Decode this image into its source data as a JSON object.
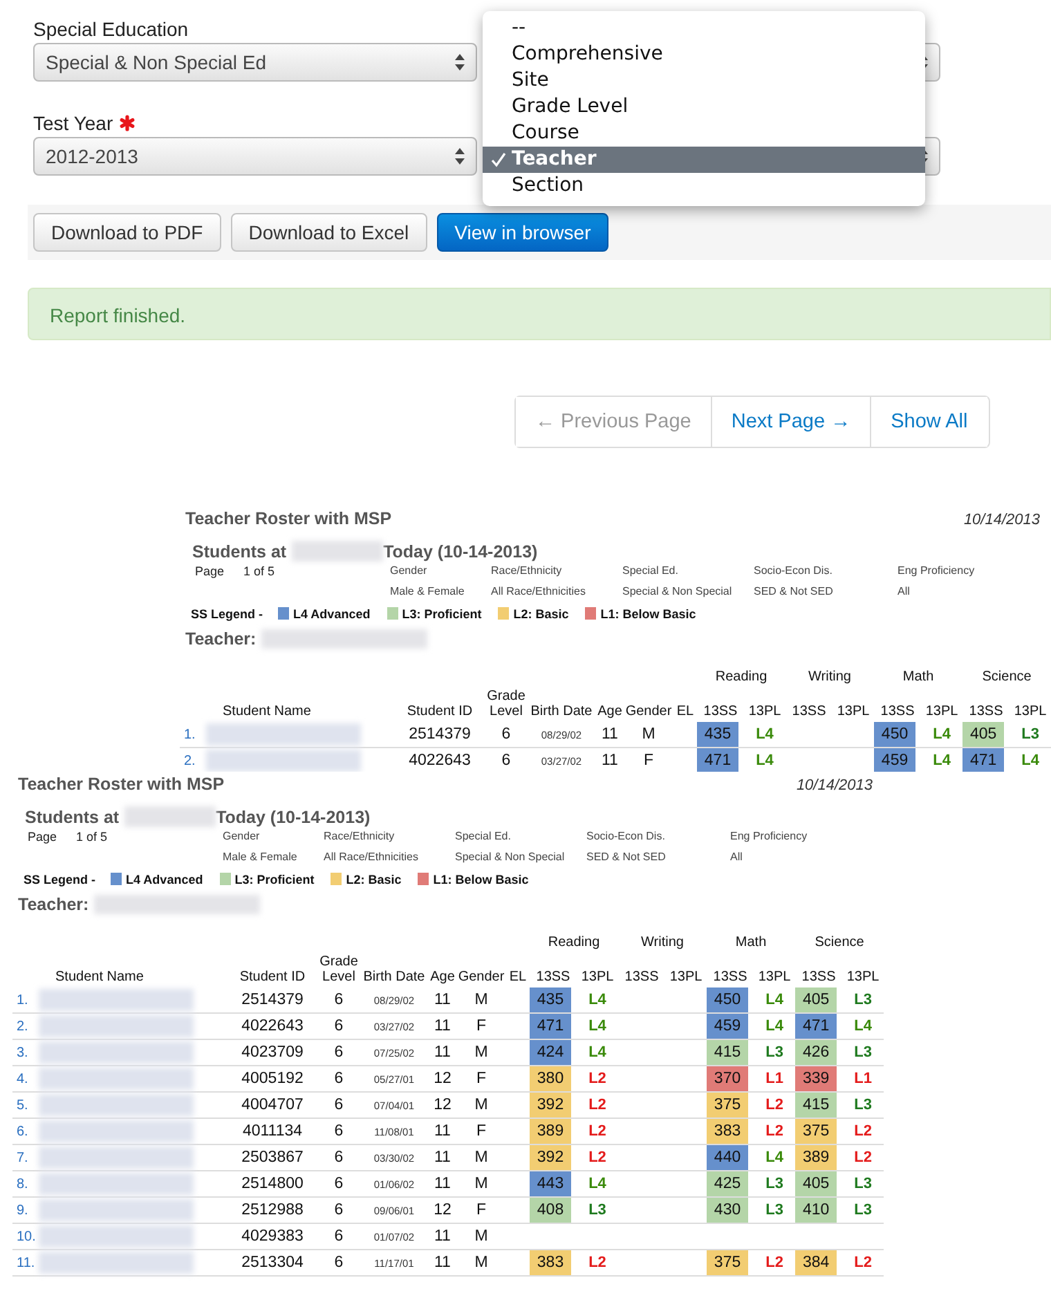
{
  "form": {
    "fields": [
      {
        "label": "Special Education",
        "value": "Special & Non Special Ed",
        "required": false
      },
      {
        "label": "Test Year",
        "value": "2012-2013",
        "required": true
      }
    ],
    "group_by_menu": {
      "options": [
        {
          "label": "--",
          "selected": false
        },
        {
          "label": "Comprehensive",
          "selected": false
        },
        {
          "label": "Site",
          "selected": false
        },
        {
          "label": "Grade Level",
          "selected": false
        },
        {
          "label": "Course",
          "selected": false
        },
        {
          "label": "Teacher",
          "selected": true
        },
        {
          "label": "Section",
          "selected": false
        }
      ]
    }
  },
  "buttons": [
    {
      "label": "Download to PDF",
      "kind": "default"
    },
    {
      "label": "Download to Excel",
      "kind": "default"
    },
    {
      "label": "View in browser",
      "kind": "primary"
    }
  ],
  "alert": "Report finished.",
  "pagination": [
    {
      "label": "← Previous Page",
      "disabled": true
    },
    {
      "label": "Next Page →",
      "disabled": false
    },
    {
      "label": "Show All",
      "disabled": false
    }
  ],
  "reports": [
    {
      "title": "Teacher Roster with MSP",
      "date": "10/14/2013",
      "students_at": "Students at",
      "students_suffix": "Today (10-14-2013)",
      "page_label": "Page",
      "page_value": "1 of 5",
      "filters": [
        {
          "label": "Gender",
          "value": "Male & Female"
        },
        {
          "label": "Race/Ethnicity",
          "value": "All Race/Ethnicities"
        },
        {
          "label": "Special Ed.",
          "value": "Special & Non Special"
        },
        {
          "label": "Socio-Econ Dis.",
          "value": "SED & Not SED"
        },
        {
          "label": "Eng Proficiency",
          "value": "All"
        }
      ],
      "legend_label": "SS Legend -",
      "legend": [
        {
          "label": "L4 Advanced",
          "color": "#6690cc"
        },
        {
          "label": "L3: Proficient",
          "color": "#b4d5a8"
        },
        {
          "label": "L2: Basic",
          "color": "#f2cd72"
        },
        {
          "label": "L1: Below Basic",
          "color": "#e07b77"
        }
      ],
      "teacher_label": "Teacher:",
      "columns": [
        "Student Name",
        "Student ID",
        "Grade Level",
        "Birth Date",
        "Age",
        "Gender",
        "EL"
      ],
      "subjects": [
        {
          "name": "Reading",
          "columns": [
            "13SS",
            "13PL"
          ]
        },
        {
          "name": "Writing",
          "columns": [
            "13SS",
            "13PL"
          ]
        },
        {
          "name": "Math",
          "columns": [
            "13SS",
            "13PL"
          ]
        },
        {
          "name": "Science",
          "columns": [
            "13SS",
            "13PL"
          ]
        }
      ],
      "rows": [
        {
          "number": "1.",
          "id": "2514379",
          "grade": "6",
          "birth": "08/29/02",
          "age": "11",
          "gender": "M",
          "scores": [
            {
              "kind": "score",
              "ss": "435",
              "pl": "L4",
              "color": "#6690cc"
            },
            {
              "kind": "empty"
            },
            {
              "kind": "score",
              "ss": "450",
              "pl": "L4",
              "color": "#6690cc"
            },
            {
              "kind": "score",
              "ss": "405",
              "pl": "L3",
              "color": "#b4d5a8"
            }
          ]
        },
        {
          "number": "2.",
          "id": "4022643",
          "grade": "6",
          "birth": "03/27/02",
          "age": "11",
          "gender": "F",
          "scores": [
            {
              "kind": "score",
              "ss": "471",
              "pl": "L4",
              "color": "#6690cc"
            },
            {
              "kind": "empty"
            },
            {
              "kind": "score",
              "ss": "459",
              "pl": "L4",
              "color": "#6690cc"
            },
            {
              "kind": "score",
              "ss": "471",
              "pl": "L4",
              "color": "#6690cc"
            }
          ]
        }
      ]
    },
    {
      "title": "Teacher Roster with MSP",
      "date": "10/14/2013",
      "students_at": "Students at",
      "students_suffix": "Today (10-14-2013)",
      "page_label": "Page",
      "page_value": "1 of 5",
      "filters": [
        {
          "label": "Gender",
          "value": "Male & Female"
        },
        {
          "label": "Race/Ethnicity",
          "value": "All Race/Ethnicities"
        },
        {
          "label": "Special Ed.",
          "value": "Special & Non Special"
        },
        {
          "label": "Socio-Econ Dis.",
          "value": "SED & Not SED"
        },
        {
          "label": "Eng Proficiency",
          "value": "All"
        }
      ],
      "legend_label": "SS Legend -",
      "legend": [
        {
          "label": "L4 Advanced",
          "color": "#6690cc"
        },
        {
          "label": "L3: Proficient",
          "color": "#b4d5a8"
        },
        {
          "label": "L2: Basic",
          "color": "#f2cd72"
        },
        {
          "label": "L1: Below Basic",
          "color": "#e07b77"
        }
      ],
      "teacher_label": "Teacher:",
      "columns": [
        "Student Name",
        "Student ID",
        "Grade Level",
        "Birth Date",
        "Age",
        "Gender",
        "EL"
      ],
      "subjects": [
        {
          "name": "Reading",
          "columns": [
            "13SS",
            "13PL"
          ]
        },
        {
          "name": "Writing",
          "columns": [
            "13SS",
            "13PL"
          ]
        },
        {
          "name": "Math",
          "columns": [
            "13SS",
            "13PL"
          ]
        },
        {
          "name": "Science",
          "columns": [
            "13SS",
            "13PL"
          ]
        }
      ],
      "rows": [
        {
          "number": "1.",
          "id": "2514379",
          "grade": "6",
          "birth": "08/29/02",
          "age": "11",
          "gender": "M",
          "scores": [
            {
              "kind": "score",
              "ss": "435",
              "pl": "L4",
              "color": "#6690cc"
            },
            {
              "kind": "empty"
            },
            {
              "kind": "score",
              "ss": "450",
              "pl": "L4",
              "color": "#6690cc"
            },
            {
              "kind": "score",
              "ss": "405",
              "pl": "L3",
              "color": "#b4d5a8"
            }
          ]
        },
        {
          "number": "2.",
          "id": "4022643",
          "grade": "6",
          "birth": "03/27/02",
          "age": "11",
          "gender": "F",
          "scores": [
            {
              "kind": "score",
              "ss": "471",
              "pl": "L4",
              "color": "#6690cc"
            },
            {
              "kind": "empty"
            },
            {
              "kind": "score",
              "ss": "459",
              "pl": "L4",
              "color": "#6690cc"
            },
            {
              "kind": "score",
              "ss": "471",
              "pl": "L4",
              "color": "#6690cc"
            }
          ]
        },
        {
          "number": "3.",
          "id": "4023709",
          "grade": "6",
          "birth": "07/25/02",
          "age": "11",
          "gender": "M",
          "scores": [
            {
              "kind": "score",
              "ss": "424",
              "pl": "L4",
              "color": "#6690cc"
            },
            {
              "kind": "empty"
            },
            {
              "kind": "score",
              "ss": "415",
              "pl": "L3",
              "color": "#b4d5a8"
            },
            {
              "kind": "score",
              "ss": "426",
              "pl": "L3",
              "color": "#b4d5a8"
            }
          ]
        },
        {
          "number": "4.",
          "id": "4005192",
          "grade": "6",
          "birth": "05/27/01",
          "age": "12",
          "gender": "F",
          "scores": [
            {
              "kind": "score",
              "ss": "380",
              "pl": "L2",
              "color": "#f2cd72"
            },
            {
              "kind": "empty"
            },
            {
              "kind": "score",
              "ss": "370",
              "pl": "L1",
              "color": "#e07b77"
            },
            {
              "kind": "score",
              "ss": "339",
              "pl": "L1",
              "color": "#e07b77"
            }
          ]
        },
        {
          "number": "5.",
          "id": "4004707",
          "grade": "6",
          "birth": "07/04/01",
          "age": "12",
          "gender": "M",
          "scores": [
            {
              "kind": "score",
              "ss": "392",
              "pl": "L2",
              "color": "#f2cd72"
            },
            {
              "kind": "empty"
            },
            {
              "kind": "score",
              "ss": "375",
              "pl": "L2",
              "color": "#f2cd72"
            },
            {
              "kind": "score",
              "ss": "415",
              "pl": "L3",
              "color": "#b4d5a8"
            }
          ]
        },
        {
          "number": "6.",
          "id": "4011134",
          "grade": "6",
          "birth": "11/08/01",
          "age": "11",
          "gender": "F",
          "scores": [
            {
              "kind": "score",
              "ss": "389",
              "pl": "L2",
              "color": "#f2cd72"
            },
            {
              "kind": "empty"
            },
            {
              "kind": "score",
              "ss": "383",
              "pl": "L2",
              "color": "#f2cd72"
            },
            {
              "kind": "score",
              "ss": "375",
              "pl": "L2",
              "color": "#f2cd72"
            }
          ]
        },
        {
          "number": "7.",
          "id": "2503867",
          "grade": "6",
          "birth": "03/30/02",
          "age": "11",
          "gender": "M",
          "scores": [
            {
              "kind": "score",
              "ss": "392",
              "pl": "L2",
              "color": "#f2cd72"
            },
            {
              "kind": "empty"
            },
            {
              "kind": "score",
              "ss": "440",
              "pl": "L4",
              "color": "#6690cc"
            },
            {
              "kind": "score",
              "ss": "389",
              "pl": "L2",
              "color": "#f2cd72"
            }
          ]
        },
        {
          "number": "8.",
          "id": "2514800",
          "grade": "6",
          "birth": "01/06/02",
          "age": "11",
          "gender": "M",
          "scores": [
            {
              "kind": "score",
              "ss": "443",
              "pl": "L4",
              "color": "#6690cc"
            },
            {
              "kind": "empty"
            },
            {
              "kind": "score",
              "ss": "425",
              "pl": "L3",
              "color": "#b4d5a8"
            },
            {
              "kind": "score",
              "ss": "405",
              "pl": "L3",
              "color": "#b4d5a8"
            }
          ]
        },
        {
          "number": "9.",
          "id": "2512988",
          "grade": "6",
          "birth": "09/06/01",
          "age": "12",
          "gender": "F",
          "scores": [
            {
              "kind": "score",
              "ss": "408",
              "pl": "L3",
              "color": "#b4d5a8"
            },
            {
              "kind": "empty"
            },
            {
              "kind": "score",
              "ss": "430",
              "pl": "L3",
              "color": "#b4d5a8"
            },
            {
              "kind": "score",
              "ss": "410",
              "pl": "L3",
              "color": "#b4d5a8"
            }
          ]
        },
        {
          "number": "10.",
          "id": "4029383",
          "grade": "6",
          "birth": "01/07/02",
          "age": "11",
          "gender": "M",
          "scores": [
            {
              "kind": "empty"
            },
            {
              "kind": "empty"
            },
            {
              "kind": "empty"
            },
            {
              "kind": "empty"
            }
          ]
        },
        {
          "number": "11.",
          "id": "2513304",
          "grade": "6",
          "birth": "11/17/01",
          "age": "11",
          "gender": "M",
          "scores": [
            {
              "kind": "score",
              "ss": "383",
              "pl": "L2",
              "color": "#f2cd72"
            },
            {
              "kind": "empty"
            },
            {
              "kind": "score",
              "ss": "375",
              "pl": "L2",
              "color": "#f2cd72"
            },
            {
              "kind": "score",
              "ss": "384",
              "pl": "L2",
              "color": "#f2cd72"
            }
          ]
        }
      ]
    }
  ]
}
